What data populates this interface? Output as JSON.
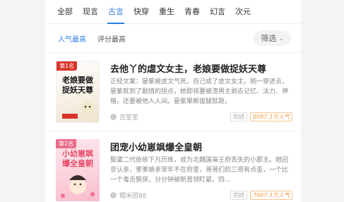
{
  "tabs": [
    {
      "label": "全部"
    },
    {
      "label": "现言"
    },
    {
      "label": "古言"
    },
    {
      "label": "快穿"
    },
    {
      "label": "重生"
    },
    {
      "label": "青春"
    },
    {
      "label": "幻言"
    },
    {
      "label": "次元"
    }
  ],
  "active_tab": "古言",
  "sort": {
    "popular": "人气最高",
    "rating": "评分最高"
  },
  "filter": {
    "label": "筛选"
  },
  "books": [
    {
      "rank": "第1名",
      "cover_text": "老娘要做捉妖天尊",
      "title": "去他丫的虐文女主，老娘要做捉妖天尊",
      "desc": "正经文案：晏紫被虐文气死，自己成了虐文女主。刚一穿进去，晏紫就到了剧情的拐点，她即将要被渣男主剥去记忆、法力、神格，还要被他入人间。晏紫果断拔腿就跑，",
      "author": "吉笙笙",
      "status": "完结",
      "popularity": "8097.3万人气",
      "accent": "#d9342b"
    },
    {
      "rank": "第2名",
      "cover_text": "小幼崽飒爆全皇朝",
      "title": "团宠小幼崽飒爆全皇朝",
      "desc": "鬓黛二代依依下凡历练，成为北魏国枭王府丢失的小郡主。她回京认亲，爹爹娘亲常年不在府里，哥哥们的三观有点歪，一个比一个毒舌狠戾，分分钟被新首领盯紧。四...",
      "author": "糯米团88",
      "status": "完结",
      "popularity": "7987.3万人气",
      "accent": "#ea6c8a"
    }
  ]
}
